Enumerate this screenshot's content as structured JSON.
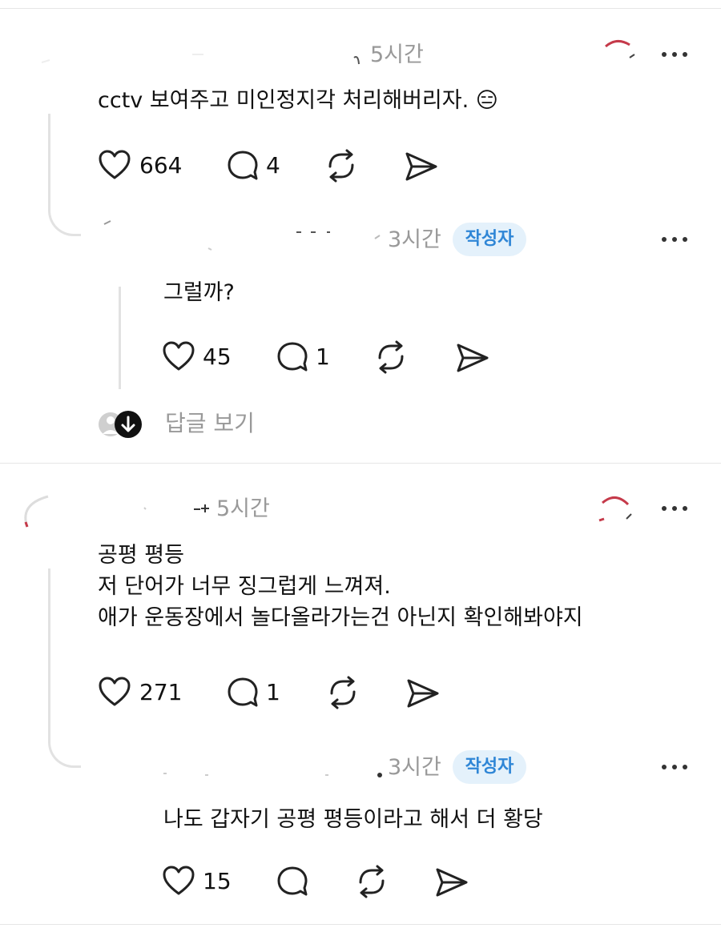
{
  "comments": [
    {
      "time": "5시간",
      "text": "cctv 보여주고 미인정지각 처리해버리자.",
      "emoji": "😑",
      "likes": "664",
      "replies": "4",
      "reply": {
        "time": "3시간",
        "badge": "작성자",
        "text": "그럴까?",
        "likes": "45",
        "replies": "1"
      },
      "view_replies": "답글 보기"
    },
    {
      "time": "5시간",
      "text": "공평 평등\n저 단어가 너무 징그럽게 느껴져.\n애가 운동장에서 놀다올라가는건 아닌지 확인해봐야지",
      "likes": "271",
      "replies": "1",
      "reply": {
        "time": "3시간",
        "badge": "작성자",
        "text": "나도 갑자기 공평 평등이라고 해서 더 황당",
        "likes": "15"
      }
    }
  ],
  "icons": {
    "like": "heart-outline-icon",
    "comment": "speech-bubble-icon",
    "repost": "repost-arrows-icon",
    "share": "paper-plane-icon",
    "more": "more-dots-icon",
    "expand": "arrow-down-circle-icon"
  },
  "colors": {
    "badge_bg": "#e4f1fb",
    "badge_text": "#2f86d6",
    "muted": "#999999",
    "divider": "#e6e6e6"
  }
}
